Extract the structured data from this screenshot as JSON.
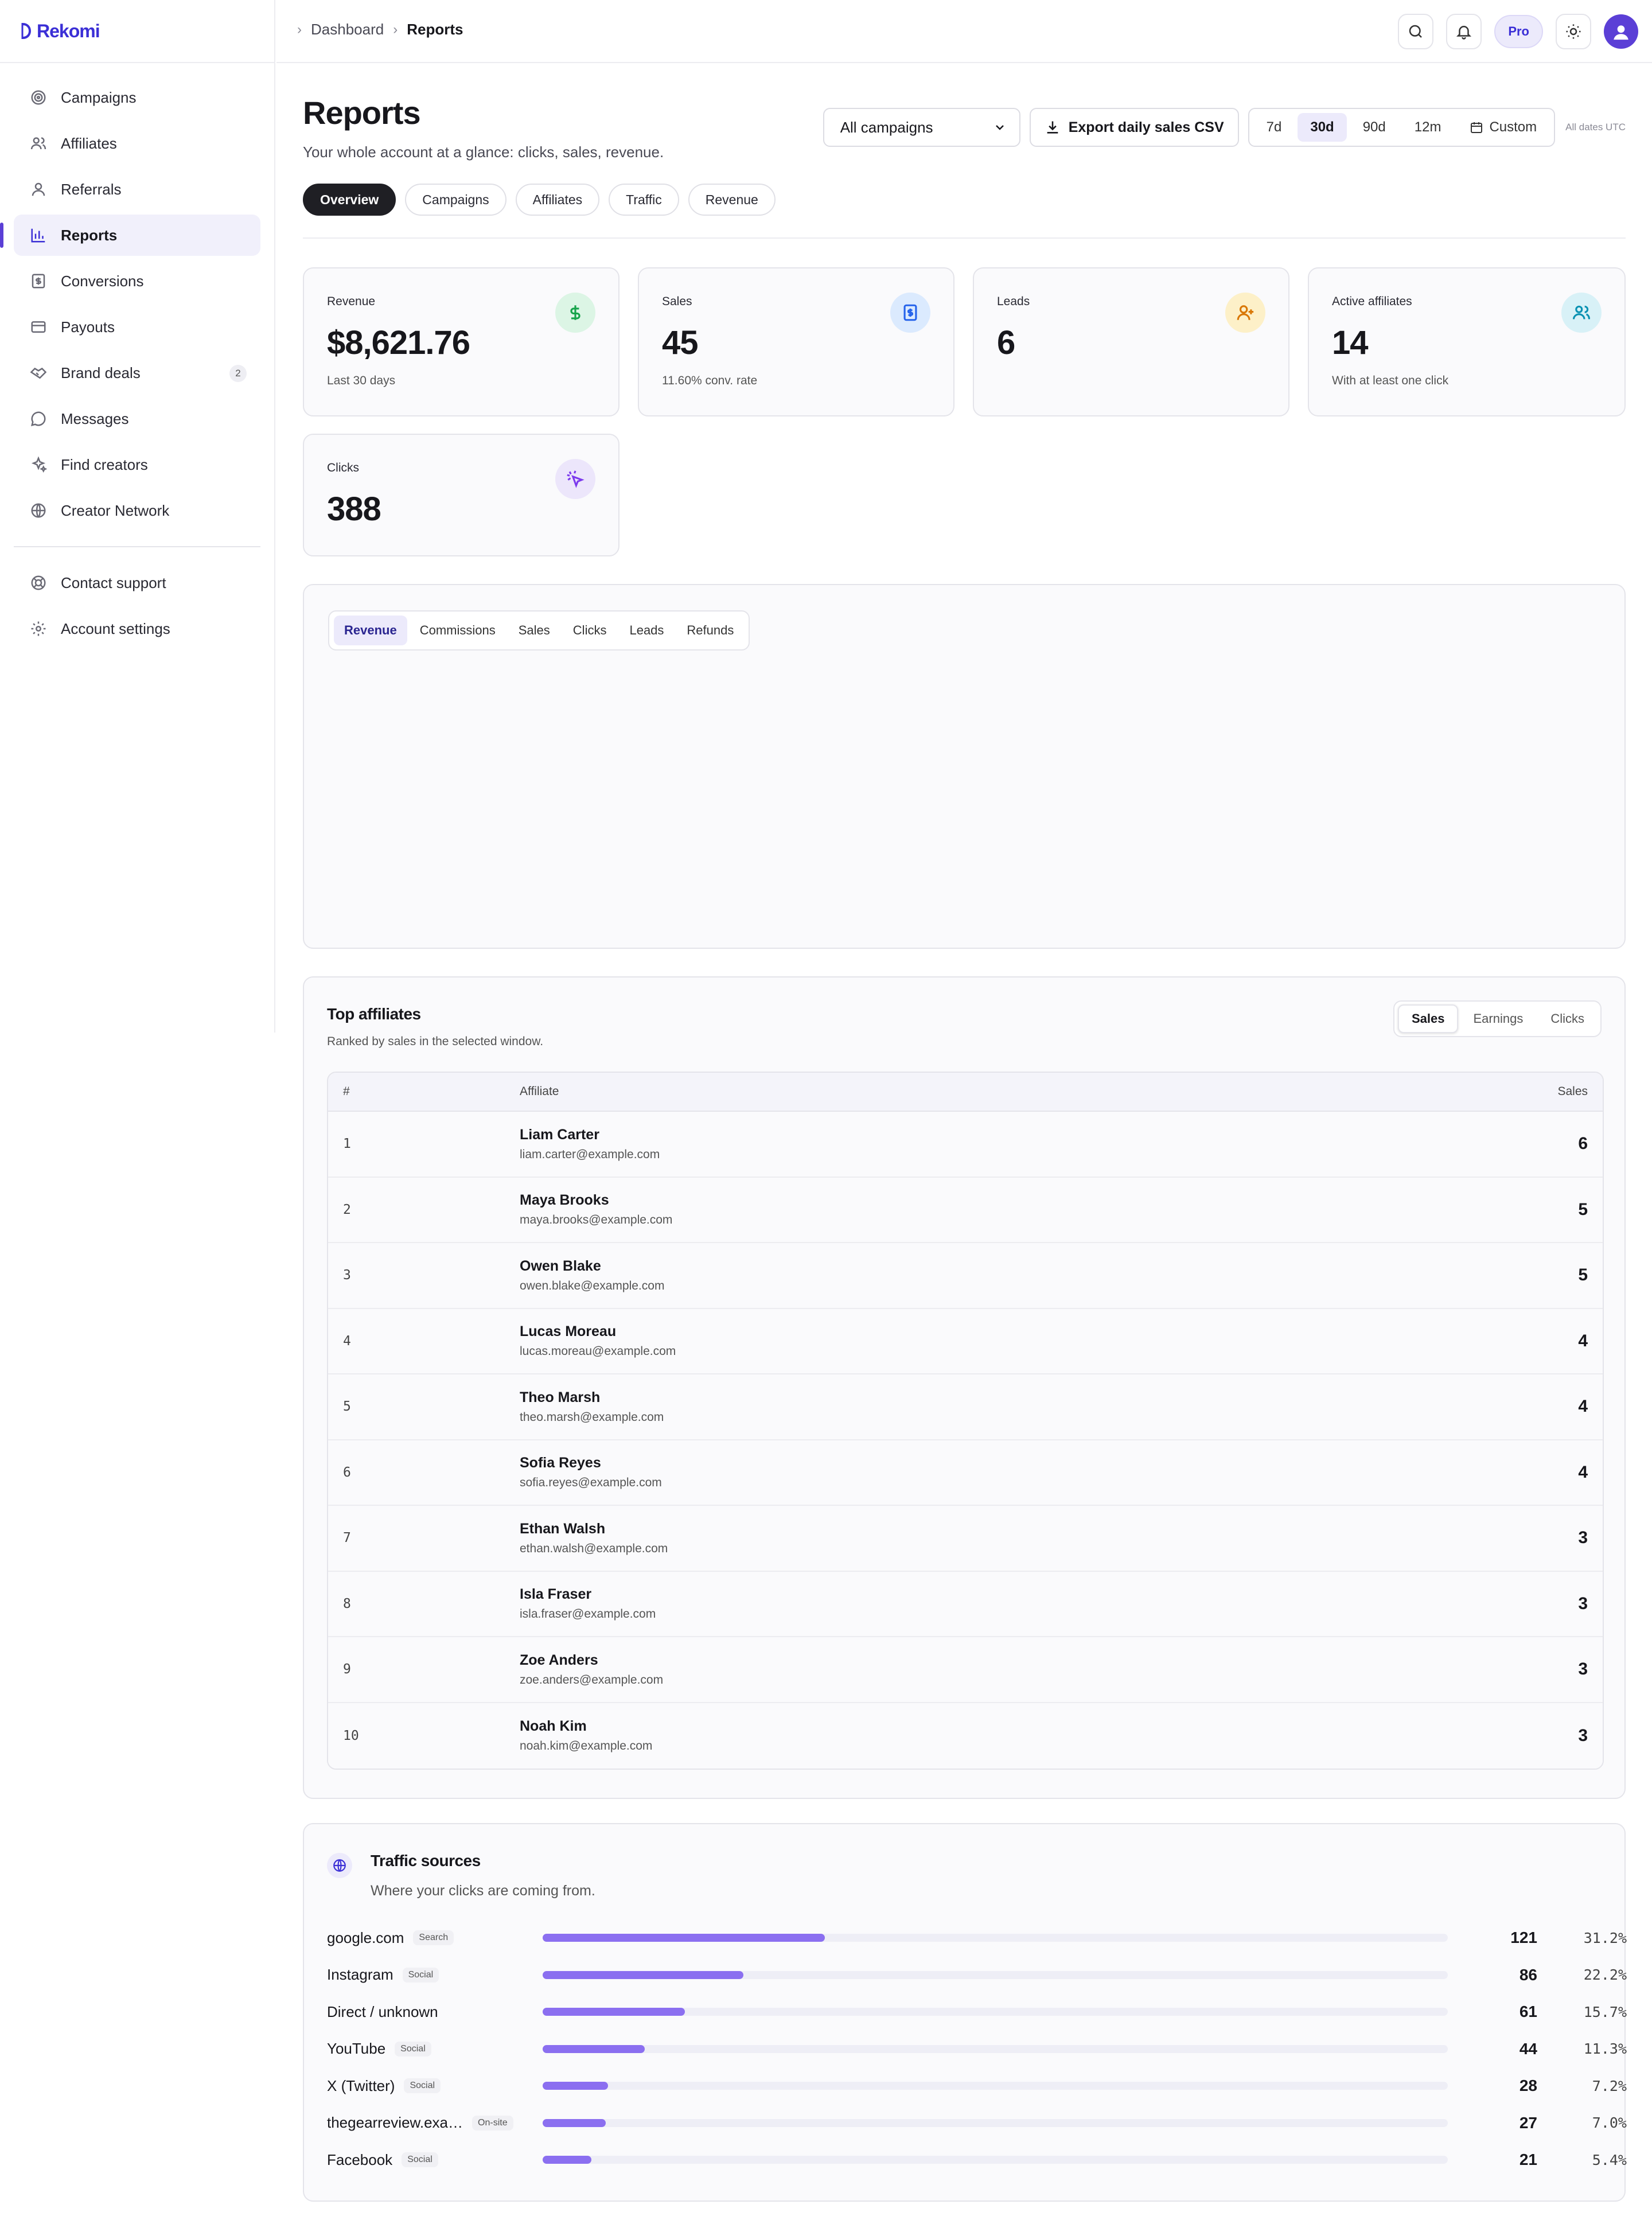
{
  "app": {
    "name": "Rekomi"
  },
  "breadcrumb": {
    "parent": "Dashboard",
    "current": "Reports"
  },
  "header": {
    "plan_badge": "Pro"
  },
  "sidebar": {
    "items": [
      {
        "label": "Campaigns",
        "icon": "target-icon"
      },
      {
        "label": "Affiliates",
        "icon": "users-icon"
      },
      {
        "label": "Referrals",
        "icon": "user-icon"
      },
      {
        "label": "Reports",
        "icon": "bar-chart-icon",
        "active": true
      },
      {
        "label": "Conversions",
        "icon": "receipt-icon"
      },
      {
        "label": "Payouts",
        "icon": "wallet-icon"
      },
      {
        "label": "Brand deals",
        "icon": "handshake-icon",
        "badge": "2"
      },
      {
        "label": "Messages",
        "icon": "message-icon"
      },
      {
        "label": "Find creators",
        "icon": "sparkle-icon"
      },
      {
        "label": "Creator Network",
        "icon": "globe-icon"
      }
    ],
    "bottom": [
      {
        "label": "Contact support",
        "icon": "lifebuoy-icon"
      },
      {
        "label": "Account settings",
        "icon": "gear-icon"
      }
    ]
  },
  "page": {
    "title": "Reports",
    "subtitle": "Your whole account at a glance: clicks, sales, revenue.",
    "campaign_filter": "All campaigns",
    "export_label": "Export daily sales CSV",
    "ranges": [
      "7d",
      "30d",
      "90d",
      "12m"
    ],
    "range_selected": "30d",
    "custom_label": "Custom",
    "timezone_note": "All dates UTC",
    "tabs": [
      "Overview",
      "Campaigns",
      "Affiliates",
      "Traffic",
      "Revenue"
    ],
    "tab_selected": "Overview"
  },
  "stats": {
    "revenue": {
      "label": "Revenue",
      "value": "$8,621.76",
      "note": "Last 30 days"
    },
    "sales": {
      "label": "Sales",
      "value": "45",
      "note": "11.60% conv. rate"
    },
    "leads": {
      "label": "Leads",
      "value": "6"
    },
    "active_affiliates": {
      "label": "Active affiliates",
      "value": "14",
      "note": "With at least one click"
    },
    "clicks": {
      "label": "Clicks",
      "value": "388"
    }
  },
  "chart_tabs": [
    "Revenue",
    "Commissions",
    "Sales",
    "Clicks",
    "Leads",
    "Refunds"
  ],
  "chart_tab_selected": "Revenue",
  "top_affiliates": {
    "title": "Top affiliates",
    "subtitle": "Ranked by sales in the selected window.",
    "sort_options": [
      "Sales",
      "Earnings",
      "Clicks"
    ],
    "sort_selected": "Sales",
    "columns": {
      "rank": "#",
      "affiliate": "Affiliate",
      "value": "Sales"
    },
    "rows": [
      {
        "rank": "1",
        "name": "Liam Carter",
        "email": "liam.carter@example.com",
        "sales": "6"
      },
      {
        "rank": "2",
        "name": "Maya Brooks",
        "email": "maya.brooks@example.com",
        "sales": "5"
      },
      {
        "rank": "3",
        "name": "Owen Blake",
        "email": "owen.blake@example.com",
        "sales": "5"
      },
      {
        "rank": "4",
        "name": "Lucas Moreau",
        "email": "lucas.moreau@example.com",
        "sales": "4"
      },
      {
        "rank": "5",
        "name": "Theo Marsh",
        "email": "theo.marsh@example.com",
        "sales": "4"
      },
      {
        "rank": "6",
        "name": "Sofia Reyes",
        "email": "sofia.reyes@example.com",
        "sales": "4"
      },
      {
        "rank": "7",
        "name": "Ethan Walsh",
        "email": "ethan.walsh@example.com",
        "sales": "3"
      },
      {
        "rank": "8",
        "name": "Isla Fraser",
        "email": "isla.fraser@example.com",
        "sales": "3"
      },
      {
        "rank": "9",
        "name": "Zoe Anders",
        "email": "zoe.anders@example.com",
        "sales": "3"
      },
      {
        "rank": "10",
        "name": "Noah Kim",
        "email": "noah.kim@example.com",
        "sales": "3"
      }
    ]
  },
  "traffic_sources": {
    "title": "Traffic sources",
    "subtitle": "Where your clicks are coming from.",
    "rows": [
      {
        "name": "google.com",
        "tag": "Search",
        "clicks": "121",
        "pct": "31.2%",
        "share": 0.312
      },
      {
        "name": "Instagram",
        "tag": "Social",
        "clicks": "86",
        "pct": "22.2%",
        "share": 0.222
      },
      {
        "name": "Direct / unknown",
        "tag": "",
        "clicks": "61",
        "pct": "15.7%",
        "share": 0.157
      },
      {
        "name": "YouTube",
        "tag": "Social",
        "clicks": "44",
        "pct": "11.3%",
        "share": 0.113
      },
      {
        "name": "X (Twitter)",
        "tag": "Social",
        "clicks": "28",
        "pct": "7.2%",
        "share": 0.072
      },
      {
        "name": "thegearreview.exa…",
        "tag": "On-site",
        "clicks": "27",
        "pct": "7.0%",
        "share": 0.07
      },
      {
        "name": "Facebook",
        "tag": "Social",
        "clicks": "21",
        "pct": "5.4%",
        "share": 0.054
      }
    ]
  },
  "colors": {
    "accent": "#5b3fd6",
    "bar": "#8b6ff0",
    "revenue_icon": "#16a34a",
    "sales_icon": "#2563eb",
    "leads_icon": "#d97706",
    "affiliates_icon": "#0891b2",
    "clicks_icon": "#7c3aed"
  }
}
